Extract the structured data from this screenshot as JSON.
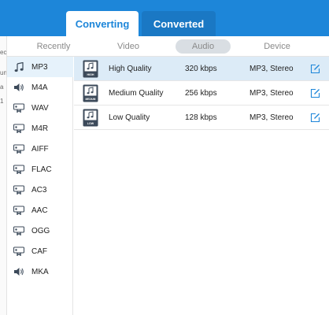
{
  "top_tabs": [
    {
      "label": "Converting",
      "active": true
    },
    {
      "label": "Converted",
      "active": false
    }
  ],
  "background_fragments": [
    "ec",
    "un",
    "a",
    "1"
  ],
  "categories": [
    {
      "label": "Recently",
      "active": false
    },
    {
      "label": "Video",
      "active": false
    },
    {
      "label": "Audio",
      "active": true
    },
    {
      "label": "Device",
      "active": false
    }
  ],
  "formats": [
    {
      "label": "MP3",
      "icon": "music-note-icon",
      "selected": true
    },
    {
      "label": "M4A",
      "icon": "speaker-icon",
      "selected": false
    },
    {
      "label": "WAV",
      "icon": "audio-device-icon",
      "selected": false
    },
    {
      "label": "M4R",
      "icon": "audio-device-icon",
      "selected": false
    },
    {
      "label": "AIFF",
      "icon": "audio-device-icon",
      "selected": false
    },
    {
      "label": "FLAC",
      "icon": "audio-device-icon",
      "selected": false
    },
    {
      "label": "AC3",
      "icon": "audio-device-icon",
      "selected": false
    },
    {
      "label": "AAC",
      "icon": "audio-device-icon",
      "selected": false
    },
    {
      "label": "OGG",
      "icon": "audio-device-icon",
      "selected": false
    },
    {
      "label": "CAF",
      "icon": "audio-device-icon",
      "selected": false
    },
    {
      "label": "MKA",
      "icon": "speaker-icon",
      "selected": false
    }
  ],
  "presets": [
    {
      "name": "High Quality",
      "bitrate": "320 kbps",
      "format": "MP3, Stereo",
      "badge": "HIGH",
      "selected": true
    },
    {
      "name": "Medium Quality",
      "bitrate": "256 kbps",
      "format": "MP3, Stereo",
      "badge": "MEDIUM",
      "selected": false
    },
    {
      "name": "Low Quality",
      "bitrate": "128 kbps",
      "format": "MP3, Stereo",
      "badge": "LOW",
      "selected": false
    }
  ],
  "colors": {
    "accent": "#1d86d9",
    "selected_row": "#dcebf7",
    "selected_format": "#e6f2fb",
    "active_category": "#d9dee3",
    "icon_dark": "#3c4a5a"
  }
}
